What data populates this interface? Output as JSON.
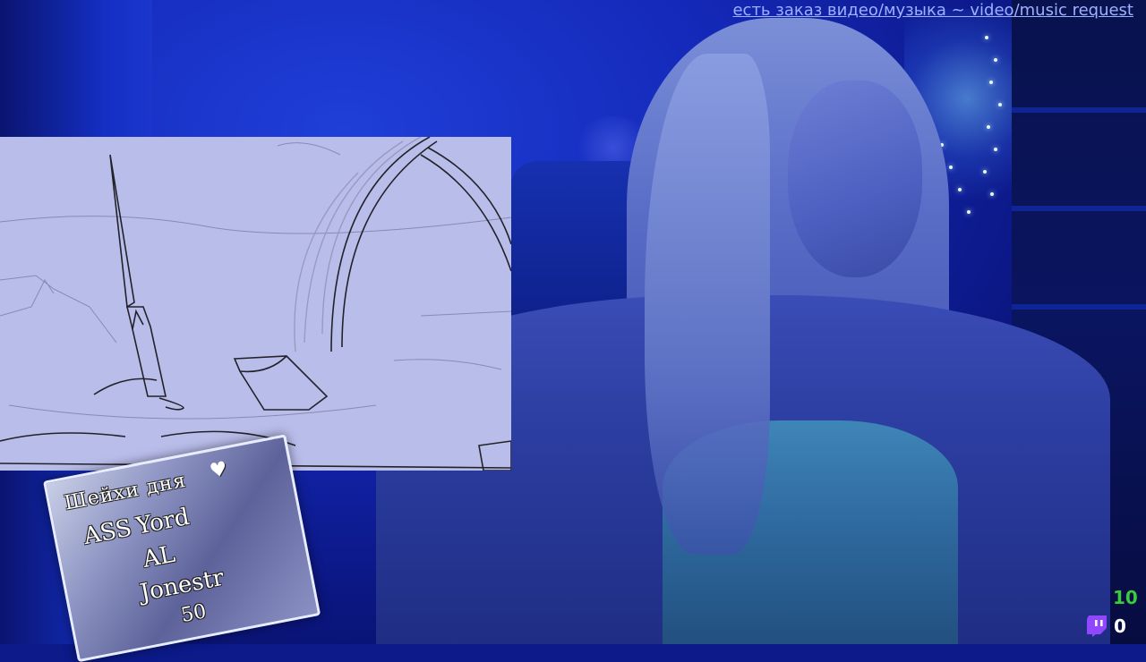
{
  "stream": {
    "request_text": "есть заказ видео/музыка ~ video/music request",
    "follower_count": "10",
    "sub_count": "0",
    "follower_color": "#3cc93c",
    "accent_color": "#9146ff"
  },
  "sign": {
    "line1": "Шейхи дня",
    "line2": "ASS",
    "line3": "Yord",
    "line4": "AL",
    "line5": "Jonestr",
    "line6": "50"
  }
}
